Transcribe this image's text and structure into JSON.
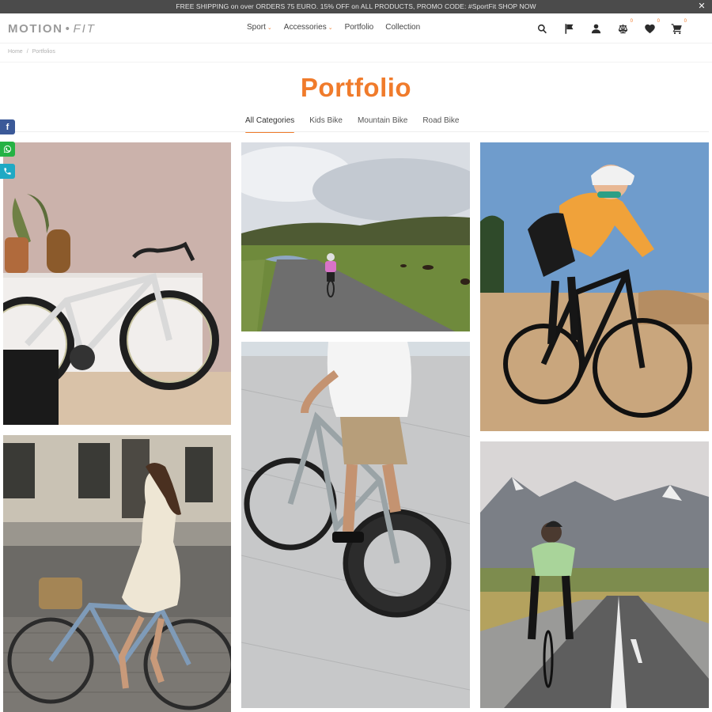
{
  "promo": {
    "text": "FREE SHIPPING on over ORDERS 75 EURO. 15% OFF on ALL PRODUCTS, PROMO CODE: #SportFit SHOP NOW",
    "close_icon": "close-icon",
    "close_glyph": "✕"
  },
  "header": {
    "logo": {
      "part1": "MOTION",
      "dot": "•",
      "part2": "FIT"
    },
    "nav": [
      {
        "label": "Sport",
        "dropdown": true,
        "chevron": "⌄"
      },
      {
        "label": "Accessories",
        "dropdown": true,
        "chevron": "⌄"
      },
      {
        "label": "Portfolio",
        "dropdown": false
      },
      {
        "label": "Collection",
        "dropdown": false
      }
    ],
    "icons": [
      {
        "name": "search-icon",
        "badge": null
      },
      {
        "name": "flag-icon",
        "badge": null
      },
      {
        "name": "user-icon",
        "badge": null
      },
      {
        "name": "compare-scale-icon",
        "badge": "0"
      },
      {
        "name": "heart-icon",
        "badge": "0"
      },
      {
        "name": "cart-icon",
        "badge": "0"
      }
    ]
  },
  "breadcrumb": {
    "items": [
      "Home",
      "Portfolios"
    ],
    "separator": "/"
  },
  "page": {
    "title": "Portfolio",
    "accent_color": "#f07b2b"
  },
  "filters": {
    "tabs": [
      {
        "label": "All Categories",
        "active": true
      },
      {
        "label": "Kids Bike",
        "active": false
      },
      {
        "label": "Mountain Bike",
        "active": false
      },
      {
        "label": "Road Bike",
        "active": false
      }
    ]
  },
  "social": [
    {
      "name": "facebook-icon",
      "glyph": "f",
      "color": "#3b5998"
    },
    {
      "name": "whatsapp-icon",
      "glyph": "",
      "color": "#25b244"
    },
    {
      "name": "viber-phone-icon",
      "glyph": "",
      "color": "#1fa9c4"
    }
  ],
  "portfolio": {
    "items": [
      {
        "description": "White road bike leaning against pink wall with plants"
      },
      {
        "description": "Cyclist in pink jersey riding on country road with grazing horses"
      },
      {
        "description": "Cyclist in orange jersey and white helmet riding black road bike"
      },
      {
        "description": "Woman in white dress riding blue city bike with basket on cobblestones"
      },
      {
        "description": "Rider in white t-shirt on fixed-gear bike with deep rims"
      },
      {
        "description": "Cyclist in green jersey riding on mountain road"
      }
    ]
  }
}
